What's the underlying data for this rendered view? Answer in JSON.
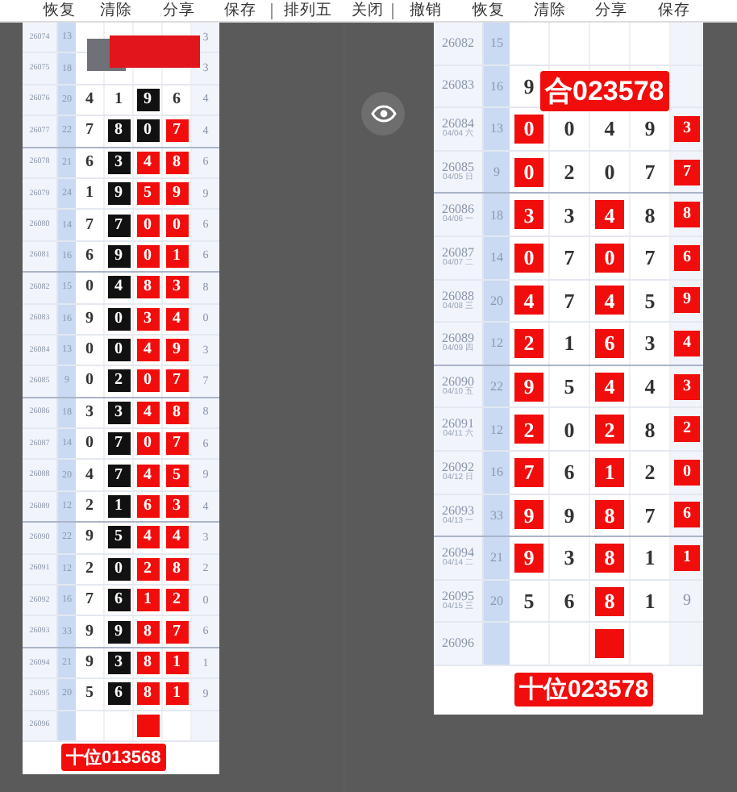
{
  "toolbar": [
    {
      "label": "恢复"
    },
    {
      "label": "清除"
    },
    {
      "label": "分享"
    },
    {
      "label": "保存"
    },
    {
      "label": "排列五"
    },
    {
      "label": "关闭"
    },
    {
      "label": "撤销"
    },
    {
      "label": "恢复"
    },
    {
      "label": "清除"
    },
    {
      "label": "分享"
    },
    {
      "label": "保存"
    }
  ],
  "left": {
    "rows": [
      {
        "issue": "26074",
        "sum": "13",
        "cells": [],
        "tail": {
          "digit": "3"
        }
      },
      {
        "issue": "26075",
        "sum": "18",
        "cells": [],
        "tail": {
          "digit": "3"
        }
      },
      {
        "issue": "26076",
        "sum": "20",
        "cells": [
          {
            "digit": "4"
          },
          {
            "digit": "1"
          },
          {
            "digit": "9",
            "color": "#111111"
          },
          {
            "digit": "6"
          }
        ],
        "tail": {
          "digit": "4"
        }
      },
      {
        "issue": "26077",
        "sum": "22",
        "cells": [
          {
            "digit": "7"
          },
          {
            "digit": "8",
            "color": "#111111"
          },
          {
            "digit": "0",
            "color": "#111111"
          },
          {
            "digit": "7",
            "color": "#f20d0d"
          }
        ],
        "tail": {
          "digit": "4"
        }
      },
      {
        "issue": "26078",
        "sum": "21",
        "cells": [
          {
            "digit": "6"
          },
          {
            "digit": "3",
            "color": "#111111"
          },
          {
            "digit": "4",
            "color": "#f20d0d"
          },
          {
            "digit": "8",
            "color": "#f20d0d"
          }
        ],
        "tail": {
          "digit": "6"
        }
      },
      {
        "issue": "26079",
        "sum": "24",
        "cells": [
          {
            "digit": "1"
          },
          {
            "digit": "9",
            "color": "#111111"
          },
          {
            "digit": "5",
            "color": "#f20d0d"
          },
          {
            "digit": "9",
            "color": "#f20d0d"
          }
        ],
        "tail": {
          "digit": "9"
        }
      },
      {
        "issue": "26080",
        "sum": "14",
        "cells": [
          {
            "digit": "7"
          },
          {
            "digit": "7",
            "color": "#111111"
          },
          {
            "digit": "0",
            "color": "#f20d0d"
          },
          {
            "digit": "0",
            "color": "#f20d0d"
          }
        ],
        "tail": {
          "digit": "6"
        }
      },
      {
        "issue": "26081",
        "sum": "16",
        "cells": [
          {
            "digit": "6"
          },
          {
            "digit": "9",
            "color": "#111111"
          },
          {
            "digit": "0",
            "color": "#f20d0d"
          },
          {
            "digit": "1",
            "color": "#f20d0d"
          }
        ],
        "tail": {
          "digit": "6"
        }
      },
      {
        "issue": "26082",
        "sum": "15",
        "cells": [
          {
            "digit": "0"
          },
          {
            "digit": "4",
            "color": "#111111"
          },
          {
            "digit": "8",
            "color": "#f20d0d"
          },
          {
            "digit": "3",
            "color": "#f20d0d"
          }
        ],
        "tail": {
          "digit": "8"
        }
      },
      {
        "issue": "26083",
        "sum": "16",
        "cells": [
          {
            "digit": "9"
          },
          {
            "digit": "0",
            "color": "#111111"
          },
          {
            "digit": "3",
            "color": "#f20d0d"
          },
          {
            "digit": "4",
            "color": "#f20d0d"
          }
        ],
        "tail": {
          "digit": "0"
        }
      },
      {
        "issue": "26084",
        "sum": "13",
        "cells": [
          {
            "digit": "0"
          },
          {
            "digit": "0",
            "color": "#111111"
          },
          {
            "digit": "4",
            "color": "#f20d0d"
          },
          {
            "digit": "9",
            "color": "#f20d0d"
          }
        ],
        "tail": {
          "digit": "3"
        }
      },
      {
        "issue": "26085",
        "sum": "9",
        "cells": [
          {
            "digit": "0"
          },
          {
            "digit": "2",
            "color": "#111111"
          },
          {
            "digit": "0",
            "color": "#f20d0d"
          },
          {
            "digit": "7",
            "color": "#f20d0d"
          }
        ],
        "tail": {
          "digit": "7"
        }
      },
      {
        "issue": "26086",
        "sum": "18",
        "cells": [
          {
            "digit": "3"
          },
          {
            "digit": "3",
            "color": "#111111"
          },
          {
            "digit": "4",
            "color": "#f20d0d"
          },
          {
            "digit": "8",
            "color": "#f20d0d"
          }
        ],
        "tail": {
          "digit": "8"
        }
      },
      {
        "issue": "26087",
        "sum": "14",
        "cells": [
          {
            "digit": "0"
          },
          {
            "digit": "7",
            "color": "#111111"
          },
          {
            "digit": "0",
            "color": "#f20d0d"
          },
          {
            "digit": "7",
            "color": "#f20d0d"
          }
        ],
        "tail": {
          "digit": "6"
        }
      },
      {
        "issue": "26088",
        "sum": "20",
        "cells": [
          {
            "digit": "4"
          },
          {
            "digit": "7",
            "color": "#111111"
          },
          {
            "digit": "4",
            "color": "#f20d0d"
          },
          {
            "digit": "5",
            "color": "#f20d0d"
          }
        ],
        "tail": {
          "digit": "9"
        }
      },
      {
        "issue": "26089",
        "sum": "12",
        "cells": [
          {
            "digit": "2"
          },
          {
            "digit": "1",
            "color": "#111111"
          },
          {
            "digit": "6",
            "color": "#f20d0d"
          },
          {
            "digit": "3",
            "color": "#f20d0d"
          }
        ],
        "tail": {
          "digit": "4"
        }
      },
      {
        "issue": "26090",
        "sum": "22",
        "cells": [
          {
            "digit": "9"
          },
          {
            "digit": "5",
            "color": "#111111"
          },
          {
            "digit": "4",
            "color": "#f20d0d"
          },
          {
            "digit": "4",
            "color": "#f20d0d"
          }
        ],
        "tail": {
          "digit": "3"
        }
      },
      {
        "issue": "26091",
        "sum": "12",
        "cells": [
          {
            "digit": "2"
          },
          {
            "digit": "0",
            "color": "#111111"
          },
          {
            "digit": "2",
            "color": "#f20d0d"
          },
          {
            "digit": "8",
            "color": "#f20d0d"
          }
        ],
        "tail": {
          "digit": "2"
        }
      },
      {
        "issue": "26092",
        "sum": "16",
        "cells": [
          {
            "digit": "7"
          },
          {
            "digit": "6",
            "color": "#111111"
          },
          {
            "digit": "1",
            "color": "#f20d0d"
          },
          {
            "digit": "2",
            "color": "#f20d0d"
          }
        ],
        "tail": {
          "digit": "0"
        }
      },
      {
        "issue": "26093",
        "sum": "33",
        "cells": [
          {
            "digit": "9"
          },
          {
            "digit": "9",
            "color": "#111111"
          },
          {
            "digit": "8",
            "color": "#f20d0d"
          },
          {
            "digit": "7",
            "color": "#f20d0d"
          }
        ],
        "tail": {
          "digit": "6"
        }
      },
      {
        "issue": "26094",
        "sum": "21",
        "cells": [
          {
            "digit": "9"
          },
          {
            "digit": "3",
            "color": "#111111"
          },
          {
            "digit": "8",
            "color": "#f20d0d"
          },
          {
            "digit": "1",
            "color": "#f20d0d"
          }
        ],
        "tail": {
          "digit": "1"
        }
      },
      {
        "issue": "26095",
        "sum": "20",
        "cells": [
          {
            "digit": "5"
          },
          {
            "digit": "6",
            "color": "#111111"
          },
          {
            "digit": "8",
            "color": "#f20d0d"
          },
          {
            "digit": "1",
            "color": "#f20d0d"
          }
        ],
        "tail": {
          "digit": "9"
        }
      },
      {
        "issue": "26096",
        "cells": [
          {},
          {},
          {
            "color": "#f20d0d"
          },
          {}
        ]
      }
    ],
    "label": "十位013568"
  },
  "right": {
    "top_label": "合023578",
    "rows": [
      {
        "issue": "26082",
        "sum": "15",
        "cells": []
      },
      {
        "issue": "26083",
        "sum": "16",
        "cells": [
          {
            "digit": "9"
          }
        ]
      },
      {
        "issue": "26084",
        "date": "04/04 六",
        "sum": "13",
        "cells": [
          {
            "digit": "0",
            "color": "#f20d0d"
          },
          {
            "digit": "0"
          },
          {
            "digit": "4"
          },
          {
            "digit": "9"
          }
        ],
        "tail": {
          "digit": "3",
          "color": "#f20d0d"
        }
      },
      {
        "issue": "26085",
        "date": "04/05 日",
        "sum": "9",
        "cells": [
          {
            "digit": "0",
            "color": "#f20d0d"
          },
          {
            "digit": "2"
          },
          {
            "digit": "0"
          },
          {
            "digit": "7"
          }
        ],
        "tail": {
          "digit": "7",
          "color": "#f20d0d"
        }
      },
      {
        "issue": "26086",
        "date": "04/06 一",
        "sum": "18",
        "cells": [
          {
            "digit": "3",
            "color": "#f20d0d"
          },
          {
            "digit": "3"
          },
          {
            "digit": "4",
            "color": "#f20d0d"
          },
          {
            "digit": "8"
          }
        ],
        "tail": {
          "digit": "8",
          "color": "#f20d0d"
        }
      },
      {
        "issue": "26087",
        "date": "04/07 二",
        "sum": "14",
        "cells": [
          {
            "digit": "0",
            "color": "#f20d0d"
          },
          {
            "digit": "7"
          },
          {
            "digit": "0",
            "color": "#f20d0d"
          },
          {
            "digit": "7"
          }
        ],
        "tail": {
          "digit": "6",
          "color": "#f20d0d"
        }
      },
      {
        "issue": "26088",
        "date": "04/08 三",
        "sum": "20",
        "cells": [
          {
            "digit": "4",
            "color": "#f20d0d"
          },
          {
            "digit": "7"
          },
          {
            "digit": "4",
            "color": "#f20d0d"
          },
          {
            "digit": "5"
          }
        ],
        "tail": {
          "digit": "9",
          "color": "#f20d0d"
        }
      },
      {
        "issue": "26089",
        "date": "04/09 四",
        "sum": "12",
        "cells": [
          {
            "digit": "2",
            "color": "#f20d0d"
          },
          {
            "digit": "1"
          },
          {
            "digit": "6",
            "color": "#f20d0d"
          },
          {
            "digit": "3"
          }
        ],
        "tail": {
          "digit": "4",
          "color": "#f20d0d"
        }
      },
      {
        "issue": "26090",
        "date": "04/10 五",
        "sum": "22",
        "cells": [
          {
            "digit": "9",
            "color": "#f20d0d"
          },
          {
            "digit": "5"
          },
          {
            "digit": "4",
            "color": "#f20d0d"
          },
          {
            "digit": "4"
          }
        ],
        "tail": {
          "digit": "3",
          "color": "#f20d0d"
        }
      },
      {
        "issue": "26091",
        "date": "04/11 六",
        "sum": "12",
        "cells": [
          {
            "digit": "2",
            "color": "#f20d0d"
          },
          {
            "digit": "0"
          },
          {
            "digit": "2",
            "color": "#f20d0d"
          },
          {
            "digit": "8"
          }
        ],
        "tail": {
          "digit": "2",
          "color": "#f20d0d"
        }
      },
      {
        "issue": "26092",
        "date": "04/12 日",
        "sum": "16",
        "cells": [
          {
            "digit": "7",
            "color": "#f20d0d"
          },
          {
            "digit": "6"
          },
          {
            "digit": "1",
            "color": "#f20d0d"
          },
          {
            "digit": "2"
          }
        ],
        "tail": {
          "digit": "0",
          "color": "#f20d0d"
        }
      },
      {
        "issue": "26093",
        "date": "04/13 一",
        "sum": "33",
        "cells": [
          {
            "digit": "9",
            "color": "#f20d0d"
          },
          {
            "digit": "9"
          },
          {
            "digit": "8",
            "color": "#f20d0d"
          },
          {
            "digit": "7"
          }
        ],
        "tail": {
          "digit": "6",
          "color": "#f20d0d"
        }
      },
      {
        "issue": "26094",
        "date": "04/14 二",
        "sum": "21",
        "cells": [
          {
            "digit": "9",
            "color": "#f20d0d"
          },
          {
            "digit": "3"
          },
          {
            "digit": "8",
            "color": "#f20d0d"
          },
          {
            "digit": "1"
          }
        ],
        "tail": {
          "digit": "1",
          "color": "#f20d0d"
        }
      },
      {
        "issue": "26095",
        "date": "04/15 三",
        "sum": "20",
        "cells": [
          {
            "digit": "5"
          },
          {
            "digit": "6"
          },
          {
            "digit": "8",
            "color": "#f20d0d"
          },
          {
            "digit": "1"
          }
        ],
        "tail": {
          "digit": "9"
        }
      },
      {
        "issue": "26096",
        "cells": [
          {},
          {},
          {
            "color": "#f20d0d"
          },
          {}
        ]
      }
    ],
    "label": "十位023578"
  }
}
